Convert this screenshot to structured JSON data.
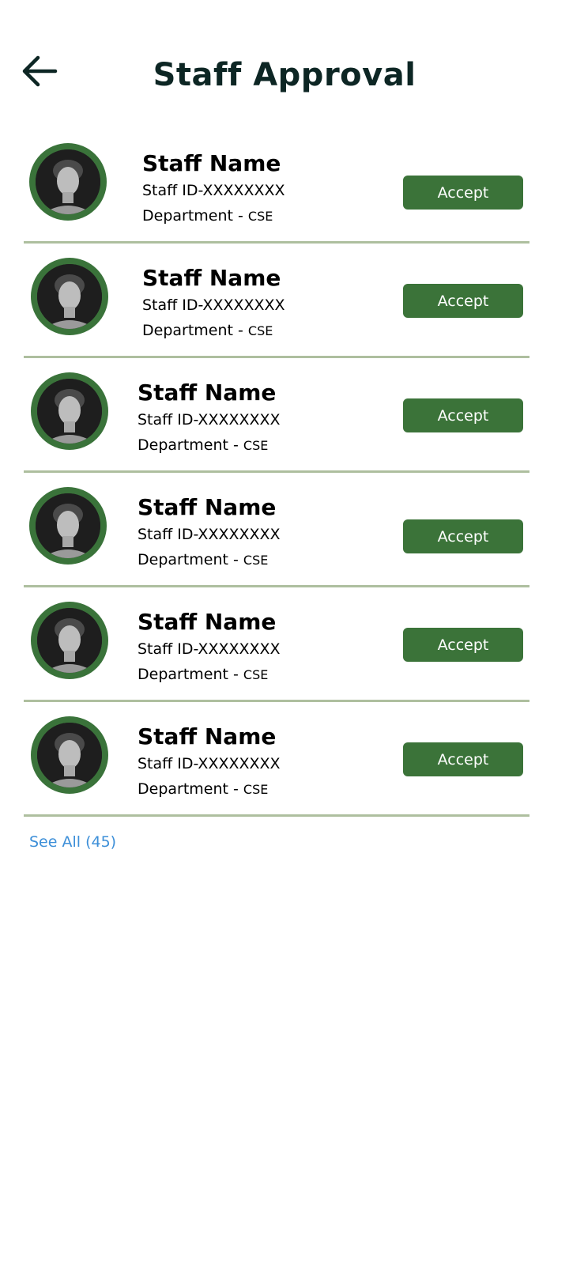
{
  "header": {
    "title": "Staff Approval",
    "back_icon": "arrow-left-icon"
  },
  "colors": {
    "title_text": "#0d2624",
    "accent_green": "#3b7339",
    "divider": "#aebf9f",
    "link_blue": "#3d8fd8"
  },
  "staff_list": [
    {
      "name": "Staff Name",
      "staff_id": "Staff ID-XXXXXXXX",
      "department_label": "Department - ",
      "department_code": "CSE",
      "accept_label": "Accept"
    },
    {
      "name": "Staff Name",
      "staff_id": "Staff ID-XXXXXXXX",
      "department_label": "Department - ",
      "department_code": "CSE",
      "accept_label": "Accept"
    },
    {
      "name": "Staff Name",
      "staff_id": "Staff ID-XXXXXXXX",
      "department_label": "Department - ",
      "department_code": "CSE",
      "accept_label": "Accept"
    },
    {
      "name": "Staff Name",
      "staff_id": "Staff ID-XXXXXXXX",
      "department_label": "Department - ",
      "department_code": "CSE",
      "accept_label": "Accept"
    },
    {
      "name": "Staff Name",
      "staff_id": "Staff ID-XXXXXXXX",
      "department_label": "Department - ",
      "department_code": "CSE",
      "accept_label": "Accept"
    },
    {
      "name": "Staff Name",
      "staff_id": "Staff ID-XXXXXXXX",
      "department_label": "Department - ",
      "department_code": "CSE",
      "accept_label": "Accept"
    }
  ],
  "footer": {
    "see_all_label": "See All (45)"
  }
}
